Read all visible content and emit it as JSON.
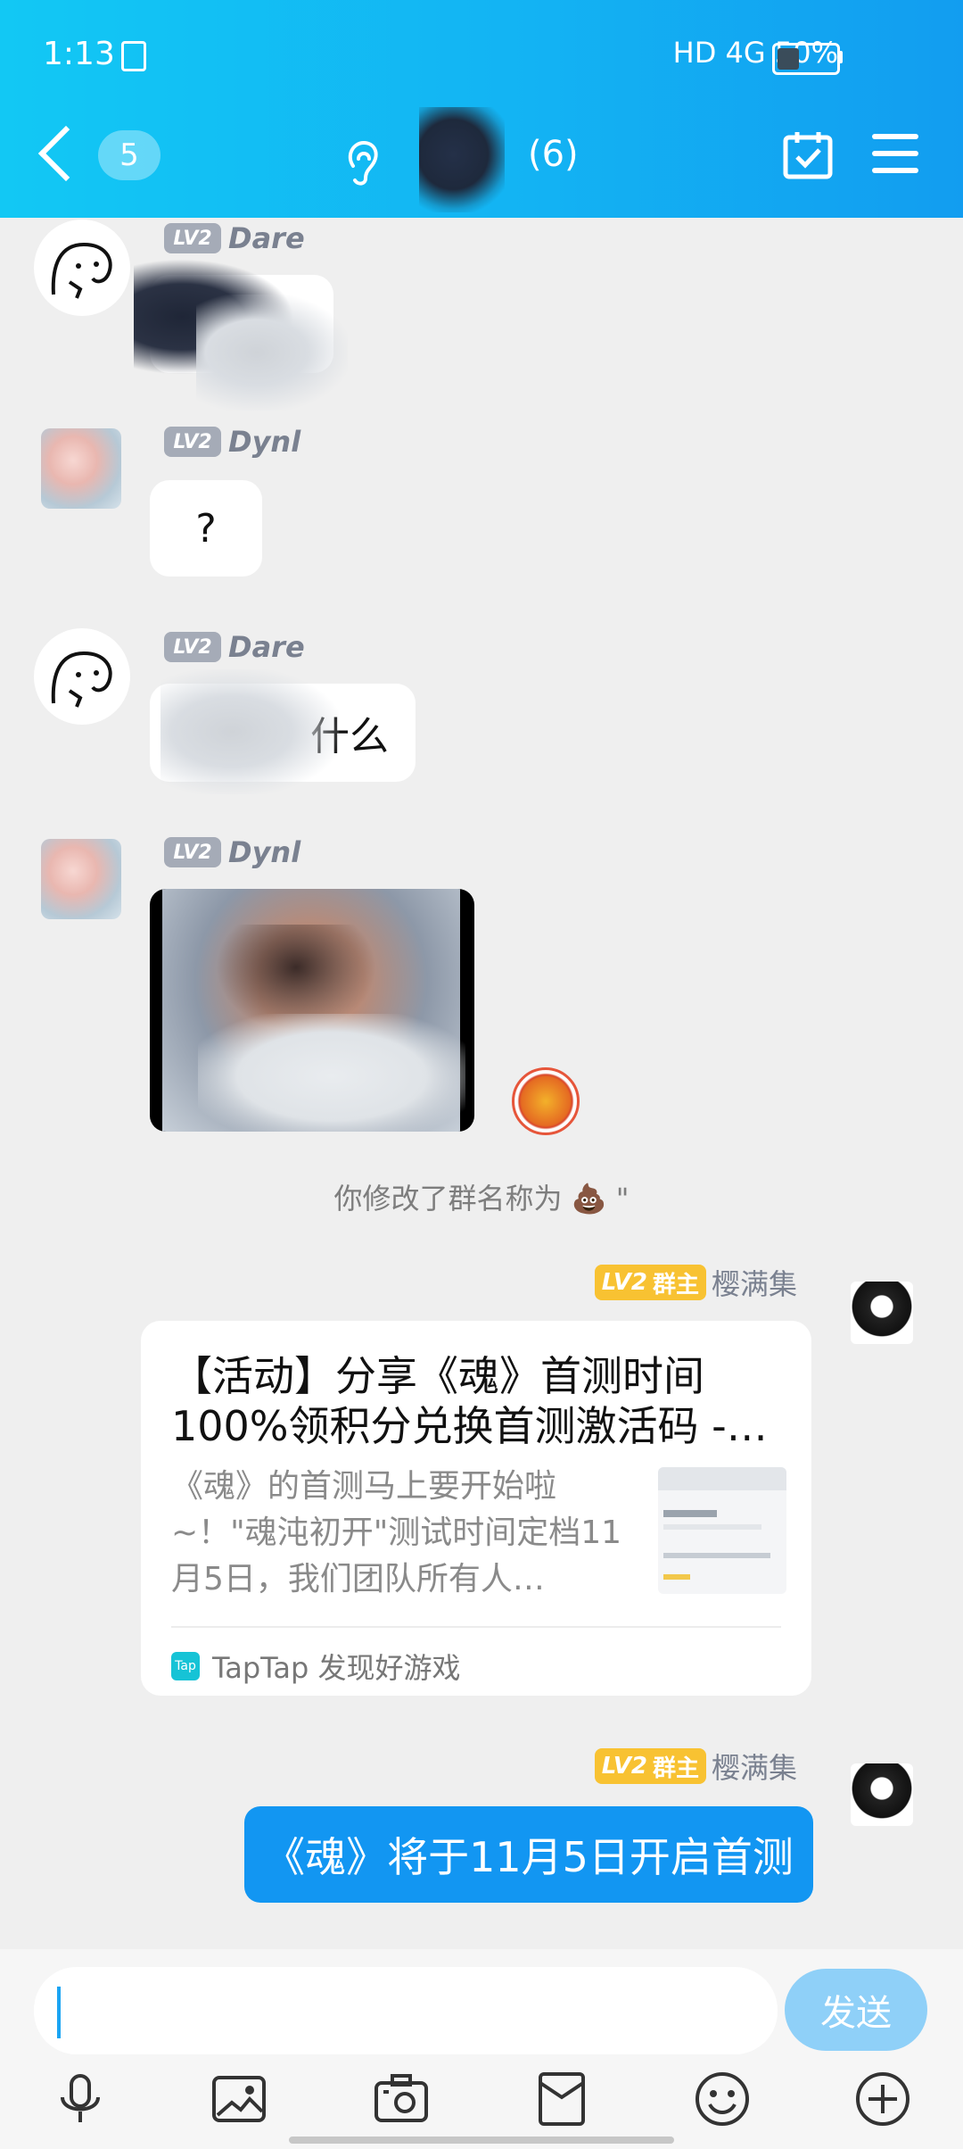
{
  "status_bar": {
    "time": "1:13",
    "right": "HD 4G  50%"
  },
  "header": {
    "unread_count": "5",
    "member_count": "(6)"
  },
  "messages": [
    {
      "nick": "Dare",
      "level": "LV2",
      "text": ""
    },
    {
      "nick": "Dynl",
      "level": "LV2",
      "text": "?"
    },
    {
      "nick": "Dare",
      "level": "LV2",
      "text": "什么"
    },
    {
      "nick": "Dynl",
      "level": "LV2",
      "text": ""
    }
  ],
  "system_message": "你修改了群名称为  💩  \"",
  "owner": {
    "level": "LV2",
    "role": "群主",
    "name": "樱满集"
  },
  "card": {
    "title": "【活动】分享《魂》首测时间100%领积分兑换首测激活码 -…",
    "desc": "《魂》的首测马上要开始啦~！\"魂沌初开\"测试时间定档11月5日，我们团队所有人…",
    "source": "TapTap 发现好游戏",
    "logo_text": "Tap"
  },
  "last_message": "《魂》将于11月5日开启首测",
  "input": {
    "placeholder": "",
    "send_label": "发送"
  },
  "toolbar": [
    "microphone-icon",
    "image-icon",
    "camera-icon",
    "red-packet-icon",
    "emoji-icon",
    "plus-icon"
  ],
  "colors": {
    "header_start": "#12c8f4",
    "header_end": "#129df0",
    "accent": "#1296f2",
    "owner_badge": "#f8c232"
  }
}
